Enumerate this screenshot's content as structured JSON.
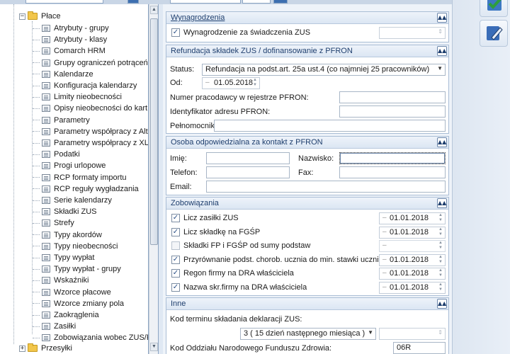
{
  "tree": {
    "root": {
      "label": "Płace",
      "expander": "−"
    },
    "items": [
      "Atrybuty - grupy",
      "Atrybuty - klasy",
      "Comarch HRM",
      "Grupy ograniczeń potrąceń",
      "Kalendarze",
      "Konfiguracja kalendarzy",
      "Limity nieobecności",
      "Opisy nieobecności do kart ...",
      "Parametry",
      "Parametry współpracy z Altum",
      "Parametry współpracy z XL",
      "Podatki",
      "Progi urlopowe",
      "RCP formaty importu",
      "RCP reguły wygładzania",
      "Serie kalendarzy",
      "Składki ZUS",
      "Strefy",
      "Typy akordów",
      "Typy nieobecności",
      "Typy wypłat",
      "Typy wypłat - grupy",
      "Wskaźniki",
      "Wzorce płacowe",
      "Wzorce zmiany pola",
      "Zaokrąglenia",
      "Zasiłki",
      "Zobowiązania wobec ZUS/P..."
    ],
    "next": {
      "label": "Przesyłki",
      "expander": "+"
    }
  },
  "sections": {
    "wynagrodzenia": {
      "title": "Wynagrodzenia",
      "checkbox_label": "Wynagrodzenie za świadczenia ZUS",
      "checked": "✓"
    },
    "pfron": {
      "title": "Refundacja składek ZUS / dofinansowanie z PFRON",
      "status_label": "Status:",
      "status_value": "Refundacja na podst.art. 25a ust.4 (co najmniej 25 pracowników)",
      "od_label": "Od:",
      "od_value": "01.05.2018",
      "nr_label": "Numer pracodawcy w rejestrze PFRON:",
      "id_label": "Identyfikator adresu PFRON:",
      "pelnomocnik_label": "Pełnomocnik:"
    },
    "osoba": {
      "title": "Osoba odpowiedzialna za kontakt z PFRON",
      "imie": "Imię:",
      "nazwisko": "Nazwisko:",
      "telefon": "Telefon:",
      "fax": "Fax:",
      "email": "Email:"
    },
    "zobowiazania": {
      "title": "Zobowiązania",
      "rows": [
        {
          "label": "Licz zasiłki ZUS",
          "check": "✓",
          "date": "01.01.2018"
        },
        {
          "label": "Licz składkę na FGŚP",
          "check": "✓",
          "date": "01.01.2018"
        },
        {
          "label": "Składki FP i FGŚP od sumy podstaw",
          "check": "",
          "date": ""
        },
        {
          "label": "Przyrównanie podst. chorob. ucznia do min. stawki ucznia",
          "check": "✓",
          "date": "01.01.2018"
        },
        {
          "label": "Regon firmy na DRA właściciela",
          "check": "✓",
          "date": "01.01.2018"
        },
        {
          "label": "Nazwa skr.firmy na DRA właściciela",
          "check": "✓",
          "date": "01.01.2018"
        }
      ]
    },
    "inne": {
      "title": "Inne",
      "kod_label": "Kod terminu składania deklaracji ZUS:",
      "kod_value": "3 ( 15 dzień następnego miesiąca )",
      "nfz_label": "Kod Oddziału Narodowego Funduszu Zdrowia:",
      "nfz_value": "06R"
    }
  },
  "icons": {
    "collapse": "▲▲",
    "dropdown": "▼"
  },
  "colors": {
    "accent": "#1f3f6e",
    "folder": "#f2c64b"
  }
}
